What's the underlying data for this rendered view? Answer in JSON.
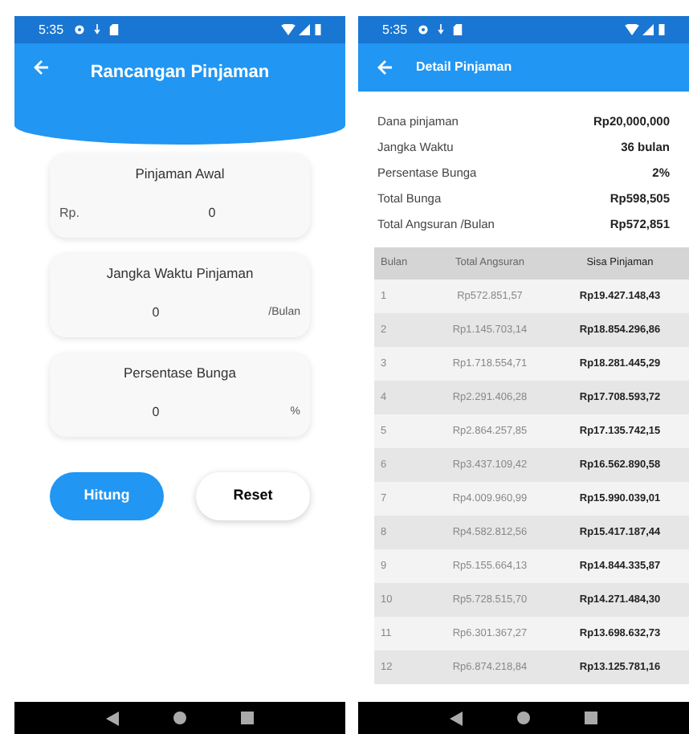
{
  "left_screen": {
    "status_bar": {
      "time": "5:35"
    },
    "app_bar": {
      "title": "Rancangan Pinjaman"
    },
    "fields": [
      {
        "label": "Pinjaman Awal",
        "prefix": "Rp.",
        "value": "0"
      },
      {
        "label": "Jangka Waktu Pinjaman",
        "value": "0",
        "suffix": "/Bulan"
      },
      {
        "label": "Persentase Bunga",
        "value": "0",
        "suffix": "%"
      }
    ],
    "buttons": [
      {
        "label": "Hitung",
        "kind": "primary"
      },
      {
        "label": "Reset",
        "kind": "secondary"
      }
    ]
  },
  "right_screen": {
    "status_bar": {
      "time": "5:35"
    },
    "app_bar": {
      "title": "Detail Pinjaman"
    },
    "summary": [
      {
        "label": "Dana pinjaman",
        "value": "Rp20,000,000"
      },
      {
        "label": "Jangka Waktu",
        "value": "36 bulan"
      },
      {
        "label": "Persentase Bunga",
        "value": "2%"
      },
      {
        "label": "Total Bunga",
        "value": "Rp598,505"
      },
      {
        "label": "Total Angsuran /Bulan",
        "value": "Rp572,851"
      }
    ],
    "table": {
      "columns": [
        "Bulan",
        "Total Angsuran",
        "Sisa Pinjaman"
      ],
      "rows": [
        [
          "1",
          "Rp572.851,57",
          "Rp19.427.148,43"
        ],
        [
          "2",
          "Rp1.145.703,14",
          "Rp18.854.296,86"
        ],
        [
          "3",
          "Rp1.718.554,71",
          "Rp18.281.445,29"
        ],
        [
          "4",
          "Rp2.291.406,28",
          "Rp17.708.593,72"
        ],
        [
          "5",
          "Rp2.864.257,85",
          "Rp17.135.742,15"
        ],
        [
          "6",
          "Rp3.437.109,42",
          "Rp16.562.890,58"
        ],
        [
          "7",
          "Rp4.009.960,99",
          "Rp15.990.039,01"
        ],
        [
          "8",
          "Rp4.582.812,56",
          "Rp15.417.187,44"
        ],
        [
          "9",
          "Rp5.155.664,13",
          "Rp14.844.335,87"
        ],
        [
          "10",
          "Rp5.728.515,70",
          "Rp14.271.484,30"
        ],
        [
          "11",
          "Rp6.301.367,27",
          "Rp13.698.632,73"
        ],
        [
          "12",
          "Rp6.874.218,84",
          "Rp13.125.781,16"
        ]
      ]
    }
  }
}
